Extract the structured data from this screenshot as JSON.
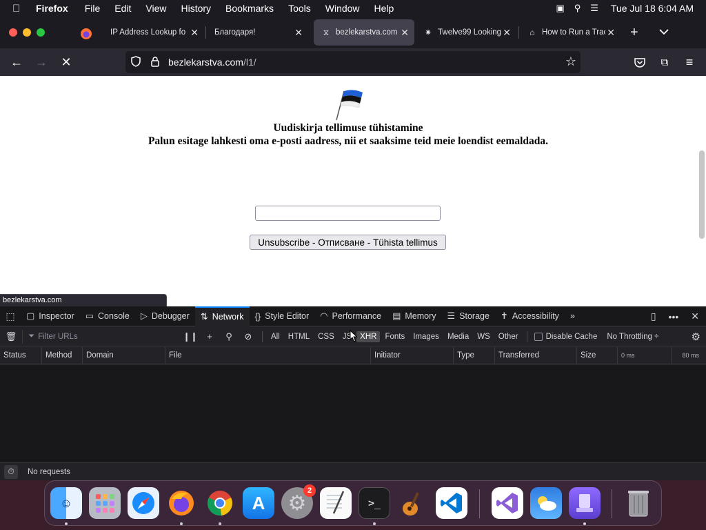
{
  "menubar": {
    "app": "Firefox",
    "items": [
      "File",
      "Edit",
      "View",
      "History",
      "Bookmarks",
      "Tools",
      "Window",
      "Help"
    ],
    "clock": "Tue Jul 18  6:04 AM"
  },
  "tabs": [
    {
      "title": "IP Address Lookup fo"
    },
    {
      "title": "Благодаря!"
    },
    {
      "title": "bezlekarstva.com"
    },
    {
      "title": "Twelve99 Looking"
    },
    {
      "title": "How to Run a Trac"
    }
  ],
  "url": {
    "host": "bezlekarstva.com",
    "path": "/l1/"
  },
  "page": {
    "heading_line1": "Uudiskirja tellimuse tühistamine",
    "heading_line2": "Palun esitage lahkesti oma e-posti aadress, nii et saaksime teid meie loendist eemaldada.",
    "email_value": "",
    "button_label": "Unsubscribe - Отписване - Tühista tellimus",
    "status_url": "bezlekarstva.com"
  },
  "devtools": {
    "tabs": [
      "Inspector",
      "Console",
      "Debugger",
      "Network",
      "Style Editor",
      "Performance",
      "Memory",
      "Storage",
      "Accessibility"
    ],
    "active_tab": "Network",
    "filter_placeholder": "Filter URLs",
    "filter_types": [
      "All",
      "HTML",
      "CSS",
      "JS",
      "XHR",
      "Fonts",
      "Images",
      "Media",
      "WS",
      "Other"
    ],
    "selected_filter": "XHR",
    "disable_cache": "Disable Cache",
    "throttling": "No Throttling ÷",
    "columns": [
      "Status",
      "Method",
      "Domain",
      "File",
      "Initiator",
      "Type",
      "Transferred",
      "Size"
    ],
    "timeline": [
      "0 ms",
      "80 ms"
    ],
    "status": "No requests"
  },
  "dock": {
    "apps": [
      "finder",
      "launchpad",
      "safari",
      "firefox",
      "chrome",
      "app-store",
      "system-settings",
      "textedit",
      "terminal",
      "garageband",
      "vscode",
      "visual-studio",
      "weather",
      "simulator",
      "trash"
    ],
    "badge": "2"
  },
  "colors": {
    "accent": "#0a84ff",
    "flag_blue": "#1f5fd6",
    "flag_black": "#111111"
  }
}
